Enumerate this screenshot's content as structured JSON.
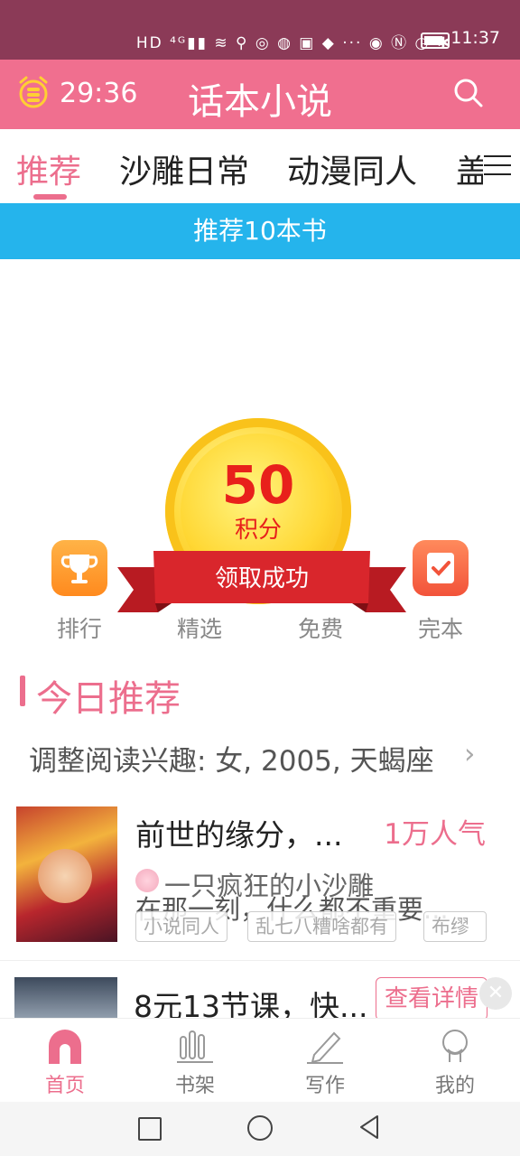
{
  "status_bar": {
    "icons_text": "HD ⁴ᴳ▮▮ ≋ ⚲ ◎ ◍ ▣ ◆ ··· ◉ Ⓝ ◷ ✱",
    "time": "11:37"
  },
  "header": {
    "timer": "29:36",
    "title": "话本小说"
  },
  "tabs": [
    {
      "label": "推荐",
      "active": true
    },
    {
      "label": "沙雕日常",
      "active": false
    },
    {
      "label": "动漫同人",
      "active": false
    },
    {
      "label": "盖",
      "active": false
    }
  ],
  "banner": {
    "text": "推荐10本书"
  },
  "reward": {
    "points": "50",
    "unit": "积分",
    "message": "领取成功"
  },
  "shortcuts": [
    {
      "label": "排行",
      "icon": "trophy-icon"
    },
    {
      "label": "精选",
      "icon": "featured-icon"
    },
    {
      "label": "免费",
      "icon": "free-icon"
    },
    {
      "label": "完本",
      "icon": "completed-icon"
    }
  ],
  "today": {
    "title": "今日推荐",
    "interest": "调整阅读兴趣: 女, 2005, 天蝎座"
  },
  "book": {
    "title": "前世的缘分，...",
    "popularity": "1万人气",
    "author": "一只疯狂的小沙雕",
    "description": "在那一刻，什么都不重要...",
    "tags": [
      "小说同人",
      "乱七八糟啥都有",
      "布缪"
    ]
  },
  "ad": {
    "title": "8元13节课，快...",
    "button": "查看详情"
  },
  "bottom_nav": [
    {
      "label": "首页",
      "active": true
    },
    {
      "label": "书架",
      "active": false
    },
    {
      "label": "写作",
      "active": false
    },
    {
      "label": "我的",
      "active": false
    }
  ],
  "colors": {
    "status_bar": "#8b3a57",
    "header": "#f06f8f",
    "accent": "#ec6e8d",
    "banner": "#25b4ec",
    "coin": "#ffd93a",
    "ribbon": "#d9262c"
  }
}
